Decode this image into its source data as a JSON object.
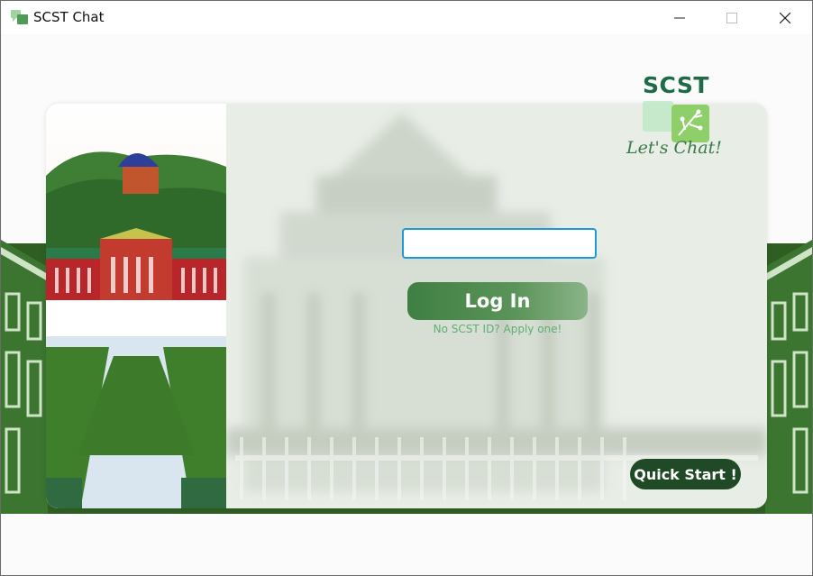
{
  "window": {
    "title": "SCST Chat",
    "controls": {
      "minimize": "minimize-icon",
      "maximize": "maximize-icon",
      "close": "close-icon"
    }
  },
  "logo": {
    "text": "SCST",
    "tagline": "Let's Chat!"
  },
  "login": {
    "id_value": "",
    "id_placeholder": "",
    "login_label": "Log In",
    "apply_link": "No SCST ID? Apply one!"
  },
  "quick_start": {
    "label": "Quick Start !"
  },
  "colors": {
    "brand_green": "#1f6b47",
    "button_green": "#3f7f43",
    "link_green": "#5fae72",
    "dark_green": "#1f4a25",
    "input_focus": "#1e9bd5",
    "ground_green": "#2f5e22"
  }
}
